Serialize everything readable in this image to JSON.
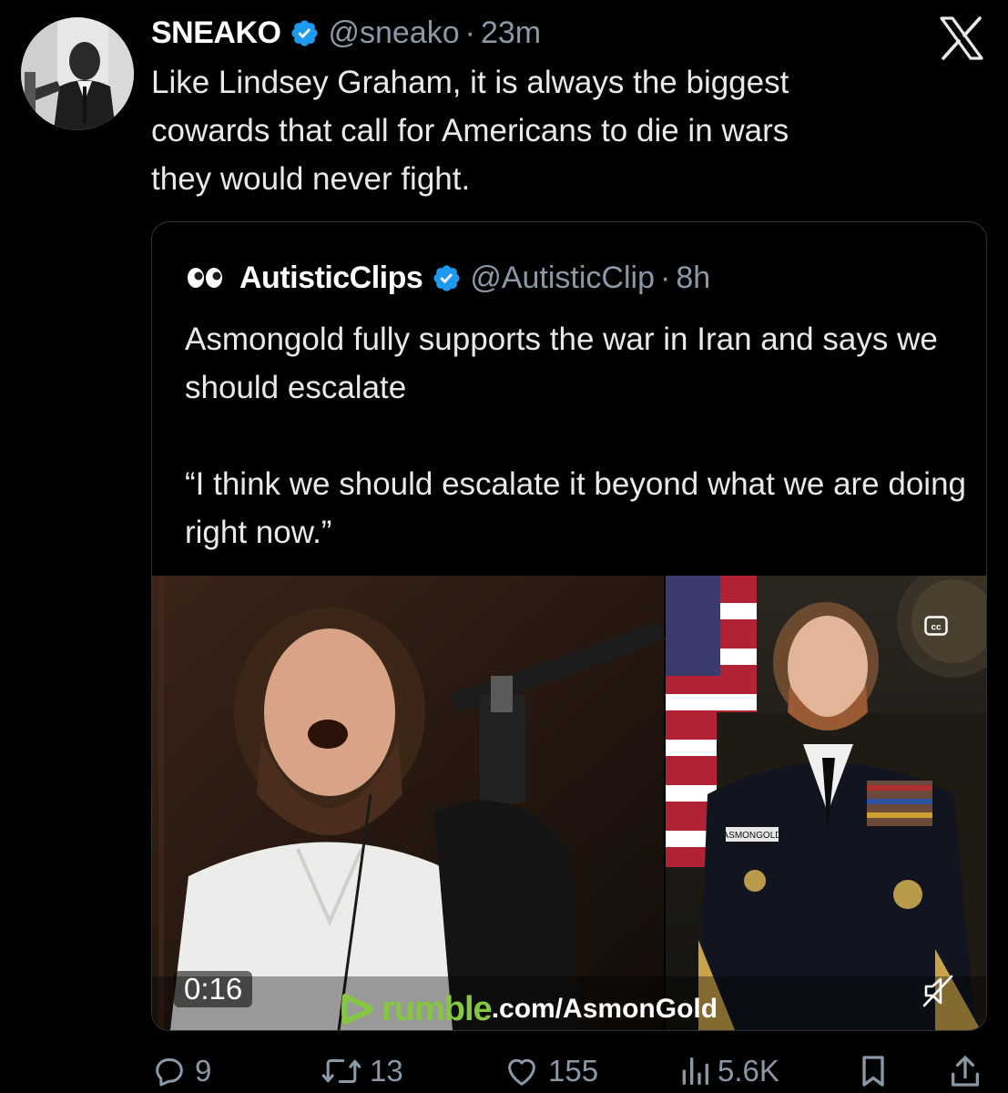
{
  "tweet": {
    "author": {
      "name": "SNEAKO",
      "handle": "@sneako",
      "time": "23m",
      "verified": true
    },
    "text": "Like Lindsey Graham, it is always the biggest\ncowards that call for Americans to die in wars\nthey would never fight."
  },
  "quote": {
    "author": {
      "name": "AutisticClips",
      "handle": "@AutisticClip",
      "time": "8h",
      "verified": true
    },
    "paragraph1": "Asmongold fully supports the war in Iran and says we should escalate",
    "paragraph2": "“I think we should escalate it beyond what we are doing right now.”",
    "video": {
      "duration": "0:16",
      "watermark_brand": "rumble",
      "watermark_path": ".com/AsmonGold",
      "name_tag": "ASMONGOLD"
    }
  },
  "actions": {
    "replies": "9",
    "reposts": "13",
    "likes": "155",
    "views": "5.6K"
  },
  "colors": {
    "background": "#000000",
    "text": "#e7e9ea",
    "muted": "#8b98a5",
    "verified": "#1d9bf0",
    "border": "#2f3336",
    "rumble_green": "#85c742"
  },
  "icons": {
    "platform_logo": "x-logo-icon",
    "verified": "verified-badge-icon",
    "quote_avatar": "eyes-emoji-icon",
    "captions": "cc-icon",
    "mute": "mute-icon",
    "reply": "reply-icon",
    "repost": "repost-icon",
    "like": "heart-icon",
    "views": "views-icon",
    "bookmark": "bookmark-icon",
    "share": "share-icon"
  }
}
